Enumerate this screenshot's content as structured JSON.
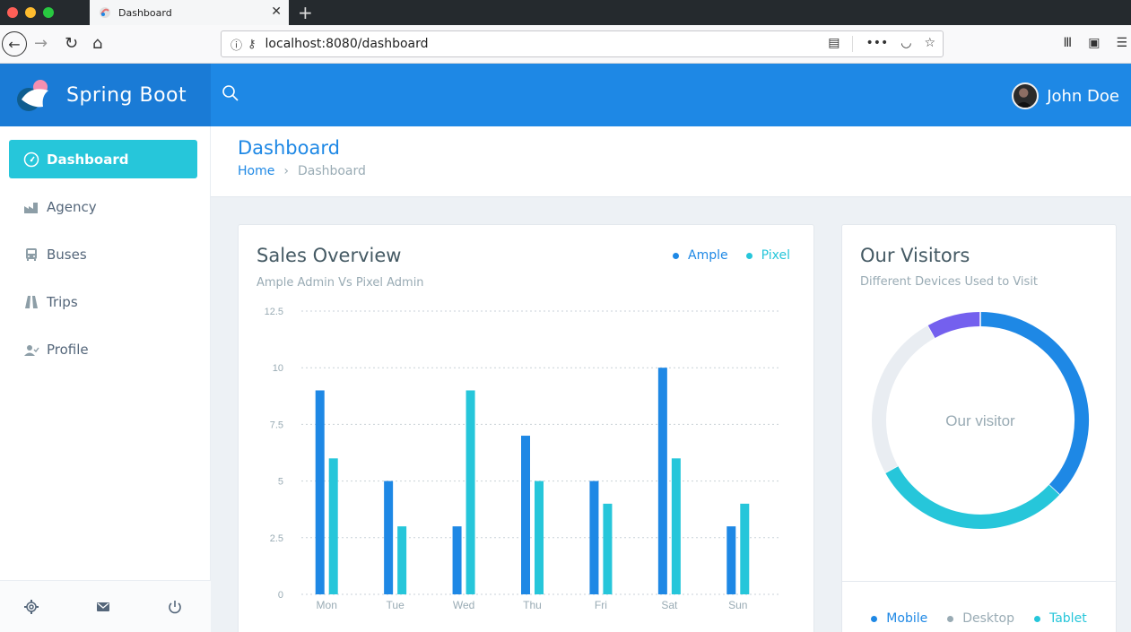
{
  "browser": {
    "tab_title": "Dashboard",
    "url": "localhost:8080/dashboard"
  },
  "header": {
    "brand": "Spring Boot",
    "user_name": "John Doe"
  },
  "sidebar": {
    "items": [
      {
        "label": "Dashboard",
        "icon": "gauge-icon"
      },
      {
        "label": "Agency",
        "icon": "factory-icon"
      },
      {
        "label": "Buses",
        "icon": "bus-icon"
      },
      {
        "label": "Trips",
        "icon": "road-icon"
      },
      {
        "label": "Profile",
        "icon": "user-check-icon"
      }
    ],
    "footer": [
      "gear-icon",
      "mail-icon",
      "power-icon"
    ]
  },
  "page": {
    "title": "Dashboard",
    "breadcrumb_home": "Home",
    "breadcrumb_current": "Dashboard"
  },
  "sales": {
    "title": "Sales Overview",
    "subtitle": "Ample Admin Vs Pixel Admin"
  },
  "visitors": {
    "title": "Our Visitors",
    "subtitle": "Different Devices Used to Visit",
    "center_label": "Our visitor"
  },
  "colors": {
    "primary": "#1e88e5",
    "info": "#26c6da",
    "purple": "#7460ee",
    "light": "#e9edf2",
    "desktop_dot": "#99abb4"
  },
  "chart_data": [
    {
      "type": "bar",
      "categories": [
        "Mon",
        "Tue",
        "Wed",
        "Thu",
        "Fri",
        "Sat",
        "Sun"
      ],
      "series": [
        {
          "name": "Ample",
          "color": "#1e88e5",
          "values": [
            9,
            5,
            3,
            7,
            5,
            10,
            3
          ]
        },
        {
          "name": "Pixel",
          "color": "#26c6da",
          "values": [
            6,
            3,
            9,
            5,
            4,
            6,
            4
          ]
        }
      ],
      "yticks": [
        "0",
        "2.5",
        "5",
        "7.5",
        "10",
        "12.5"
      ],
      "ylim": [
        0,
        12.5
      ],
      "grid": true,
      "legend": "top-right"
    },
    {
      "type": "pie",
      "segments": [
        {
          "name": "Mobile",
          "color": "#1e88e5",
          "value": 37
        },
        {
          "name": "Tablet",
          "color": "#26c6da",
          "value": 30
        },
        {
          "name": "Desktop",
          "color": "#e9edf2",
          "value": 25
        },
        {
          "name": "",
          "color": "#7460ee",
          "value": 8
        }
      ],
      "legend": "bottom"
    }
  ]
}
